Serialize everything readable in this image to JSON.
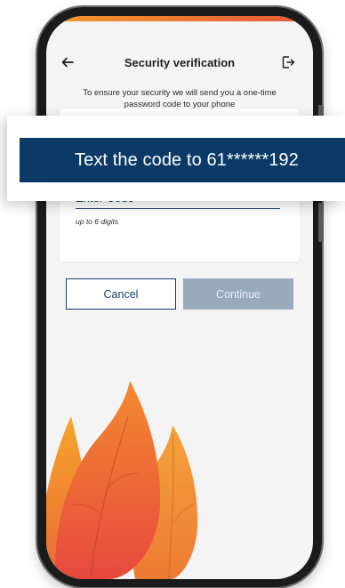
{
  "header": {
    "back_icon": "arrow-left-icon",
    "title": "Security verification",
    "logout_icon": "logout-icon"
  },
  "info": {
    "text": "To ensure your security we will send you a one-time password code to your phone"
  },
  "card": {
    "code_placeholder": "Enter Code",
    "code_value": "",
    "hint": "up to 6 digits"
  },
  "buttons": {
    "cancel_label": "Cancel",
    "continue_label": "Continue"
  },
  "banner": {
    "text": "Text the code to 61******192"
  },
  "colors": {
    "primary_navy": "#0b3a67",
    "accent_navy": "#1c3c66",
    "disabled_button": "#9aaabd",
    "screen_background": "#f4f4f4",
    "flame_orange": "#f28c28",
    "flame_red": "#e8483f"
  }
}
